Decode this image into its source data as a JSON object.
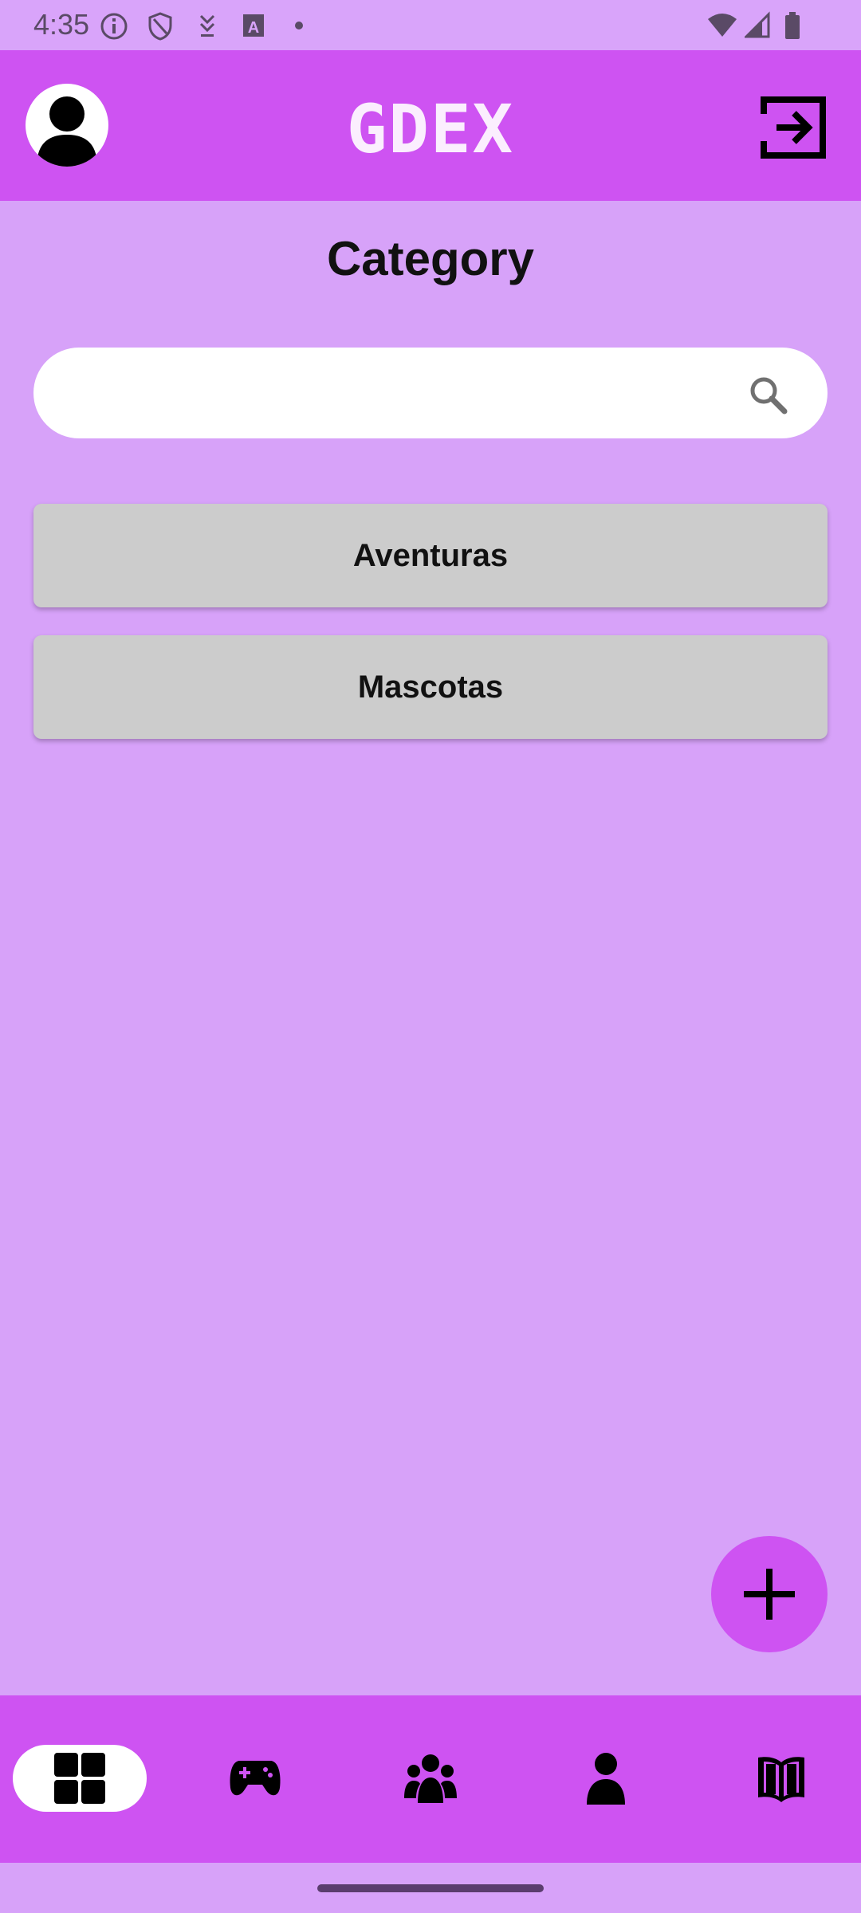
{
  "status_bar": {
    "time": "4:35",
    "left_icons": [
      "info-icon",
      "shield-icon",
      "download-icon",
      "a-icon",
      "dot-icon"
    ],
    "right_icons": [
      "wifi-icon",
      "signal-icon",
      "battery-icon"
    ]
  },
  "app_bar": {
    "title": "GDEX",
    "left_icon": "avatar-icon",
    "right_icon": "logout-icon"
  },
  "page": {
    "title": "Category"
  },
  "search": {
    "value": "",
    "placeholder": "",
    "icon": "search-icon"
  },
  "categories": [
    {
      "label": "Aventuras"
    },
    {
      "label": "Mascotas"
    }
  ],
  "fab": {
    "icon": "add-icon"
  },
  "bottom_nav": {
    "items": [
      {
        "icon": "grid-icon",
        "active": true
      },
      {
        "icon": "gamepad-icon",
        "active": false
      },
      {
        "icon": "group-icon",
        "active": false
      },
      {
        "icon": "person-icon",
        "active": false
      },
      {
        "icon": "book-icon",
        "active": false
      }
    ]
  },
  "colors": {
    "background": "#d7a2f9",
    "accent": "#ce53f2",
    "card": "#cccccc",
    "text": "#111111"
  }
}
